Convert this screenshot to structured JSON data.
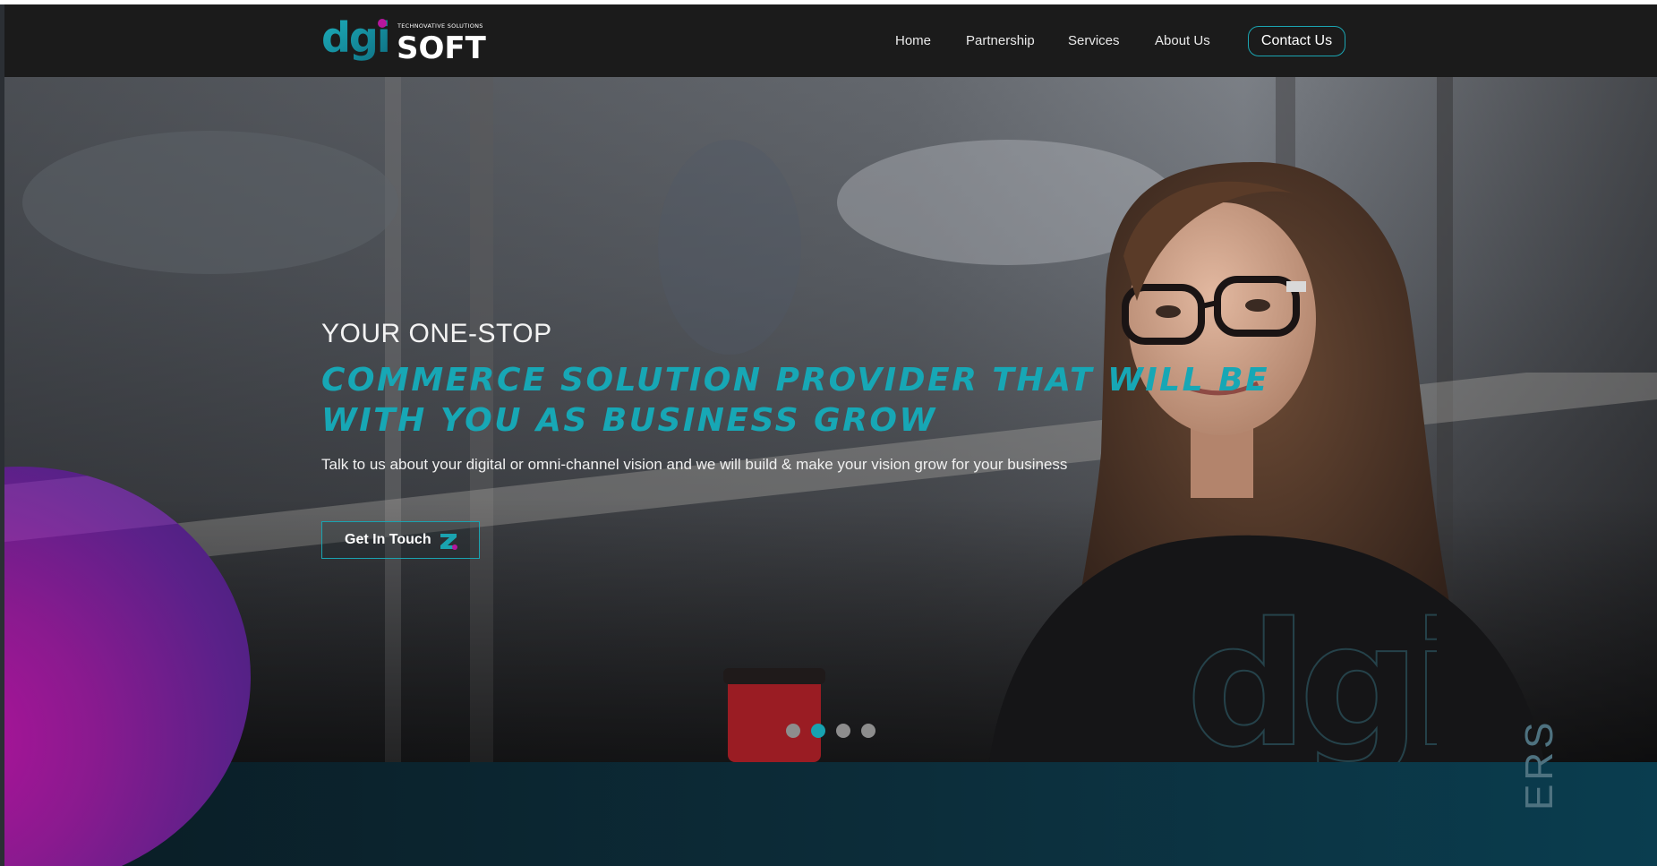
{
  "brand": {
    "logo_mark": "dgi",
    "logo_word": "SOFT",
    "tagline": "TECHNOVATIVE SOLUTIONS",
    "accent_color": "#17a7b5",
    "brand_magenta": "#b5179e"
  },
  "nav": {
    "items": [
      "Home",
      "Partnership",
      "Services",
      "About Us"
    ],
    "contact_label": "Contact Us"
  },
  "hero": {
    "kicker": "YOUR ONE-STOP",
    "title": "COMMERCE SOLUTION PROVIDER THAT WILL BE WITH YOU AS BUSINESS GROW",
    "subtitle": "Talk to us about your digital or omni-channel vision and we will build & make your vision grow for your business",
    "cta_label": "Get In Touch",
    "cta_icon": "z-arrow-icon",
    "watermark": "dgi",
    "slides": {
      "count": 4,
      "active_index": 1
    }
  },
  "band": {
    "vertical_text": "ERS"
  }
}
